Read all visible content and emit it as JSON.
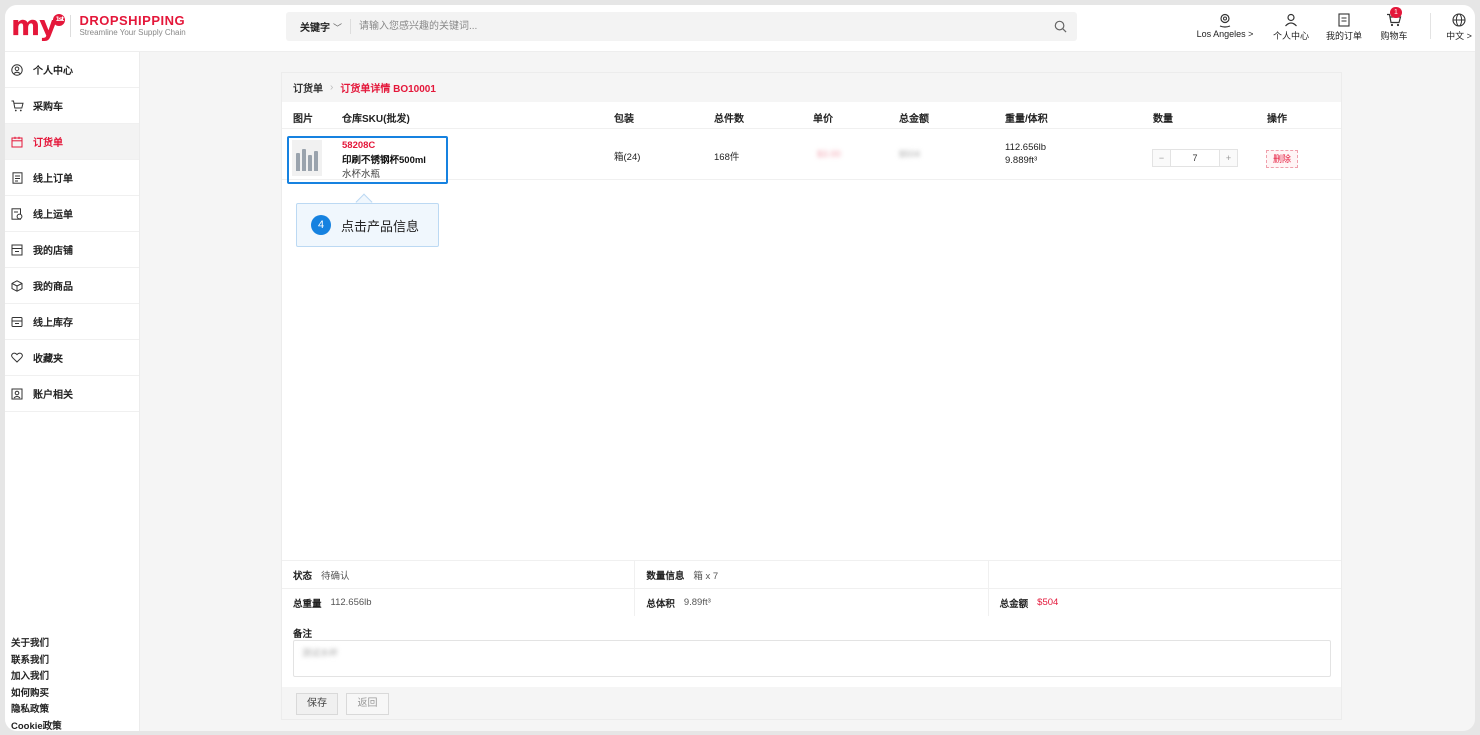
{
  "header": {
    "logo_text": "my",
    "logo_badge": "1st",
    "brand_name": "DROPSHIPPING",
    "brand_tagline": "Streamline Your Supply Chain",
    "search": {
      "category": "关键字",
      "placeholder": "请输入您感兴趣的关键词..."
    },
    "nav": {
      "location": "Los Angeles >",
      "personal": "个人中心",
      "orders": "我的订单",
      "cart": "购物车",
      "cart_count": "1",
      "language": "中文 >"
    }
  },
  "sidebar": {
    "items": [
      {
        "label": "个人中心",
        "icon": "user-circle-icon"
      },
      {
        "label": "采购车",
        "icon": "cart-icon"
      },
      {
        "label": "订货单",
        "icon": "calendar-icon"
      },
      {
        "label": "线上订单",
        "icon": "document-icon"
      },
      {
        "label": "线上运单",
        "icon": "waybill-icon"
      },
      {
        "label": "我的店铺",
        "icon": "store-icon"
      },
      {
        "label": "我的商品",
        "icon": "box-icon"
      },
      {
        "label": "线上库存",
        "icon": "inventory-icon"
      },
      {
        "label": "收藏夹",
        "icon": "heart-icon"
      },
      {
        "label": "账户相关",
        "icon": "account-icon"
      }
    ],
    "active_index": 2,
    "footer_links": [
      "关于我们",
      "联系我们",
      "加入我们",
      "如何购买",
      "隐私政策",
      "Cookie政策"
    ]
  },
  "breadcrumb": {
    "root": "订货单",
    "current": "订货单详情 BO10001"
  },
  "table": {
    "headers": [
      "图片",
      "仓库SKU(批发)",
      "包装",
      "总件数",
      "单价",
      "总金额",
      "重量/体积",
      "数量",
      "操作"
    ],
    "row": {
      "sku_code": "58208C",
      "name": "印刷不锈钢杯500ml",
      "subtitle": "水杯水瓶",
      "package": "箱(24)",
      "total_pieces": "168件",
      "unit_price": "$3.00",
      "total_amount": "$504",
      "weight": "112.656lb",
      "volume": "9.889ft³",
      "quantity": "7",
      "action": "删除"
    }
  },
  "tooltip": {
    "step": "4",
    "text": "点击产品信息"
  },
  "summary": {
    "status_label": "状态",
    "status_value": "待确认",
    "qty_label": "数量信息",
    "qty_value": "箱 x 7",
    "weight_label": "总重量",
    "weight_value": "112.656lb",
    "volume_label": "总体积",
    "volume_value": "9.89ft³",
    "amount_label": "总金额",
    "amount_value": "$504"
  },
  "notes": {
    "label": "备注",
    "value": "测试水杯"
  },
  "buttons": {
    "save": "保存",
    "back": "返回"
  },
  "colors": {
    "brand_red": "#e4173a",
    "highlight_blue": "#1682e0"
  }
}
